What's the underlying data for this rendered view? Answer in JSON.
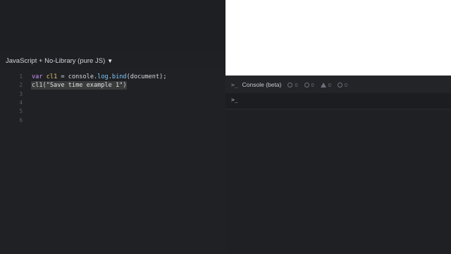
{
  "editor": {
    "language_selector": "JavaScript + No-Library (pure JS)",
    "caret_icon": "triangle-down-icon",
    "lines": [
      {
        "num": "1",
        "tokens": [
          [
            "kw",
            "var"
          ],
          [
            "plain",
            " "
          ],
          [
            "var",
            "cl1"
          ],
          [
            "plain",
            " = console."
          ],
          [
            "fn",
            "log"
          ],
          [
            "plain",
            "."
          ],
          [
            "fn",
            "bind"
          ],
          [
            "plain",
            "(document);"
          ]
        ]
      },
      {
        "num": "2",
        "tokens": [
          [
            "plain",
            "cl1("
          ],
          [
            "str",
            "\"Save time example 1\""
          ],
          [
            "plain",
            ")"
          ]
        ]
      },
      {
        "num": "3",
        "tokens": []
      },
      {
        "num": "4",
        "tokens": []
      },
      {
        "num": "5",
        "tokens": []
      },
      {
        "num": "6",
        "tokens": []
      }
    ]
  },
  "console": {
    "prompt_icon": ">_",
    "title": "Console (beta)",
    "counters": [
      {
        "icon": "clock-icon",
        "value": "0"
      },
      {
        "icon": "error-icon",
        "value": "0"
      },
      {
        "icon": "warning-icon",
        "value": "0"
      },
      {
        "icon": "info-icon",
        "value": "0"
      }
    ],
    "input_prompt": ">_"
  },
  "colors": {
    "background": "#1f2024",
    "keyword": "#c891f5",
    "variable": "#e6c66b",
    "function": "#7ec8f5",
    "preview_background": "#ffffff"
  }
}
